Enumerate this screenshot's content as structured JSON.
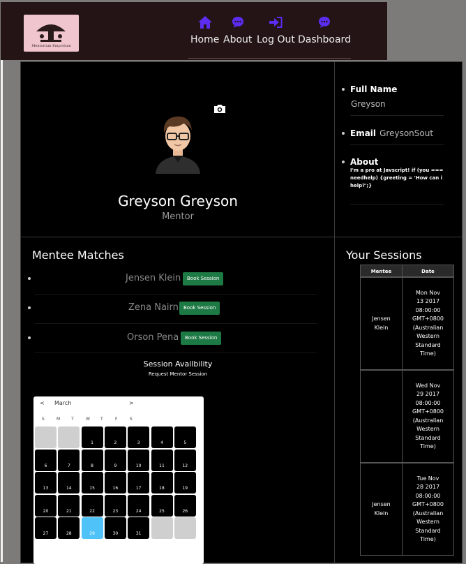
{
  "logo": {
    "text": "Mentorium Emporium"
  },
  "nav": {
    "home": {
      "label": "Home",
      "icon": "home-icon"
    },
    "about": {
      "label": "About",
      "icon": "chat-icon"
    },
    "logout": {
      "label": "Log Out",
      "icon": "sign-in-icon"
    },
    "dashboard": {
      "label": "Dashboard",
      "icon": "chat-icon"
    }
  },
  "colors": {
    "nav_icon": "#5a2df0",
    "button": "#1e7a44",
    "selected_day": "#4fc3f7",
    "topbar": "#241415"
  },
  "profile": {
    "name": "Greyson Greyson",
    "role": "Mentor"
  },
  "info": {
    "full_name_label": "Full Name",
    "full_name": "Greyson",
    "email_label": "Email",
    "email": "GreysonSout",
    "about_label": "About",
    "about_lines": [
      "I'm a pro at Javscript! if (you ===",
      "needhelp) {greeting = 'How can i",
      "help?';}"
    ]
  },
  "matches": {
    "title": "Mentee Matches",
    "items": [
      {
        "name": "Jensen Klein",
        "button": "Book Session"
      },
      {
        "name": "Zena Nairn",
        "button": "Book Session"
      },
      {
        "name": "Orson Pena",
        "button": "Book Session"
      }
    ],
    "availability_title": "Session Availbility",
    "availability_subtitle": "Request Mentor Session"
  },
  "calendar": {
    "prev": "<",
    "month": "March",
    "next": ">",
    "weekdays": [
      "S",
      "M",
      "T",
      "W",
      "T",
      "F",
      "S"
    ],
    "days": [
      "1",
      "2",
      "3",
      "4",
      "5",
      "6",
      "7",
      "8",
      "9",
      "10",
      "11",
      "12",
      "13",
      "14",
      "15",
      "16",
      "17",
      "18",
      "19",
      "20",
      "21",
      "22",
      "23",
      "24",
      "25",
      "26",
      "27",
      "28",
      "29",
      "30",
      "31"
    ],
    "selected_day": "29"
  },
  "sessions": {
    "title": "Your Sessions",
    "headers": [
      "Mentee",
      "Date"
    ],
    "rows": [
      {
        "mentee": [
          "Jensen",
          "Klein"
        ],
        "date": [
          "Mon Nov",
          "13 2017",
          "08:00:00",
          "GMT+0800",
          "(Australian",
          "Western",
          "Standard",
          "Time)"
        ]
      },
      {
        "mentee": [],
        "date": [
          "Wed Nov",
          "29 2017",
          "08:00:00",
          "GMT+0800",
          "(Australian",
          "Western",
          "Standard",
          "Time)"
        ]
      },
      {
        "mentee": [
          "Jensen",
          "Klein"
        ],
        "date": [
          "Tue Nov",
          "28 2017",
          "08:00:00",
          "GMT+0800",
          "(Australian",
          "Western",
          "Standard",
          "Time)"
        ]
      }
    ]
  }
}
